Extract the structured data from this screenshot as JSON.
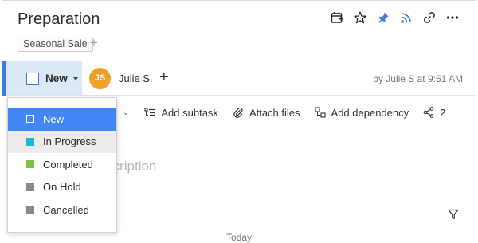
{
  "task": {
    "title": "Preparation",
    "tag": "Seasonal Sale",
    "tag_add": "+"
  },
  "toolbar_icons": [
    "calendar-add-icon",
    "star-icon",
    "pin-icon",
    "rss-icon",
    "link-icon",
    "more-icon"
  ],
  "status": {
    "current": "New",
    "assignee_initials": "JS",
    "assignee_name": "Julie S.",
    "add_assignee": "+",
    "byline": "by Julie S at 9:51 AM"
  },
  "actions": {
    "add_subtask": "Add subtask",
    "attach_files": "Attach files",
    "add_dependency": "Add dependency",
    "share_count": "2"
  },
  "description_placeholder": "e description",
  "timeline": {
    "today_label": "Today"
  },
  "dropdown": {
    "items": [
      {
        "label": "New",
        "color": "#4285f4"
      },
      {
        "label": "In Progress",
        "color": "#17b8d8"
      },
      {
        "label": "Completed",
        "color": "#7cc142"
      },
      {
        "label": "On Hold",
        "color": "#8a8a8a"
      },
      {
        "label": "Cancelled",
        "color": "#8a8a8a"
      }
    ]
  },
  "colors": {
    "accent": "#3b7ddd",
    "selected_bg": "#4285f4",
    "avatar": "#f0a028",
    "pin": "#3b7ddd",
    "rss": "#3b7ddd"
  }
}
